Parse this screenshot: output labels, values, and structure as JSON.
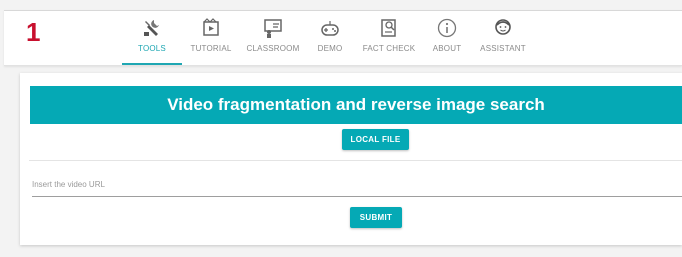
{
  "step_number": "1",
  "nav": {
    "items": [
      {
        "label": "TOOLS",
        "icon": "tools-icon",
        "active": true
      },
      {
        "label": "TUTORIAL",
        "icon": "tutorial-icon",
        "active": false
      },
      {
        "label": "CLASSROOM",
        "icon": "classroom-icon",
        "active": false
      },
      {
        "label": "DEMO",
        "icon": "gamepad-icon",
        "active": false
      },
      {
        "label": "FACT CHECK",
        "icon": "fact-check-icon",
        "active": false
      },
      {
        "label": "ABOUT",
        "icon": "info-icon",
        "active": false
      },
      {
        "label": "ASSISTANT",
        "icon": "assistant-icon",
        "active": false
      }
    ]
  },
  "panel": {
    "title": "Video fragmentation and reverse image search",
    "local_file_label": "LOCAL FILE",
    "url_placeholder": "Insert the video URL",
    "url_value": "",
    "submit_label": "SUBMIT"
  },
  "colors": {
    "accent": "#05a9b5",
    "step_badge": "#c8102e",
    "nav_text": "#8a8a8a"
  }
}
